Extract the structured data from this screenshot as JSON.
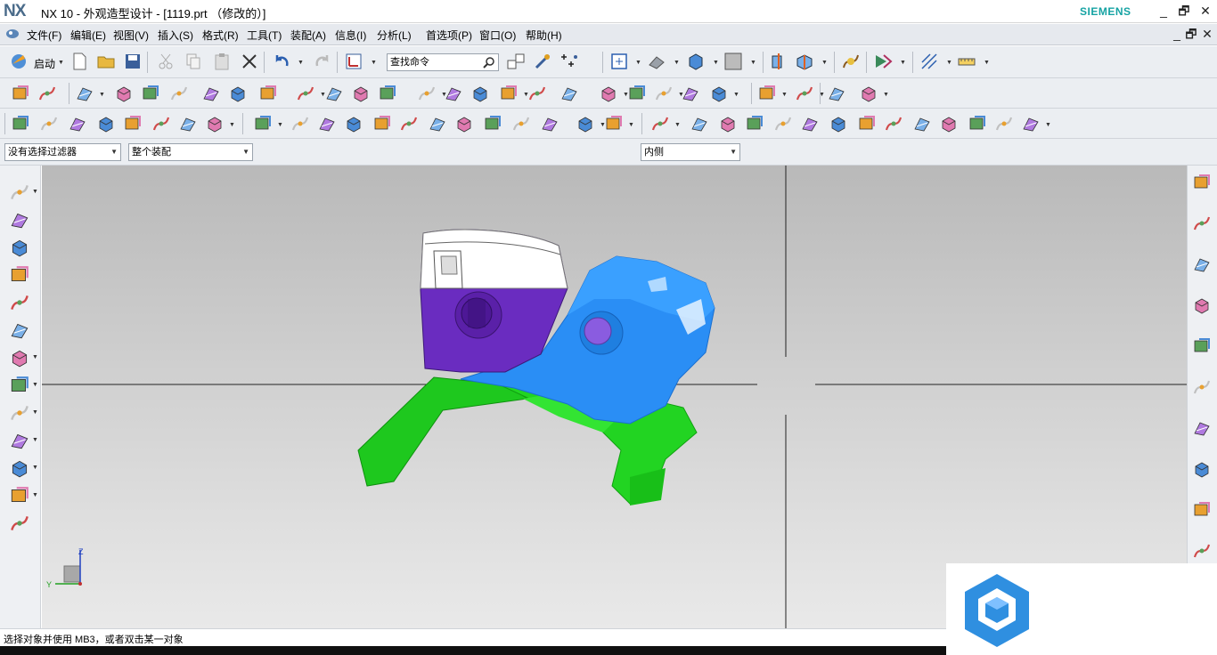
{
  "titlebar": {
    "logo": "NX",
    "title": "NX 10 - 外观造型设计 - [1119.prt  （修改的）]",
    "brand": "SIEMENS",
    "minimize": "_",
    "restore": "🗗",
    "close": "✕"
  },
  "menubar": {
    "items": [
      "文件(F)",
      "编辑(E)",
      "视图(V)",
      "插入(S)",
      "格式(R)",
      "工具(T)",
      "装配(A)",
      "信息(I)",
      "分析(L)",
      "首选项(P)",
      "窗口(O)",
      "帮助(H)"
    ],
    "doc_minimize": "_",
    "doc_restore": "🗗",
    "doc_close": "✕"
  },
  "toolbar1": {
    "start_label": "启动",
    "search_placeholder": "查找命令"
  },
  "selection_bar": {
    "filter_value": "没有选择过滤器",
    "scope_value": "整个装配",
    "select_mode_value": "内侧"
  },
  "viewport": {
    "triad": {
      "z_label": "Z",
      "y_label": "Y"
    }
  },
  "statusbar": {
    "text": "选择对象并使用 MB3，或者双击某一对象"
  },
  "colors": {
    "shell_white": "#ffffff",
    "shell_purple": "#6a2cc0",
    "scan_blue": "#2a8ef5",
    "scan_green": "#1fd11f",
    "siemens_teal": "#16a3a3"
  }
}
